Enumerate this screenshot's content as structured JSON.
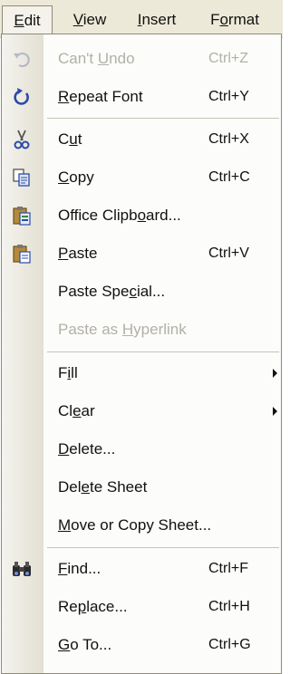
{
  "menubar": {
    "items": [
      {
        "label": "Edit",
        "mnemonic_index": 0,
        "active": true
      },
      {
        "label": "View",
        "mnemonic_index": 0
      },
      {
        "label": "Insert",
        "mnemonic_index": 0
      },
      {
        "label": "Format",
        "mnemonic_index": 1
      }
    ]
  },
  "menu": {
    "items": [
      {
        "label": "Can't Undo",
        "mnemonic_index": 6,
        "shortcut": "Ctrl+Z",
        "disabled": true,
        "icon": "undo-icon"
      },
      {
        "label": "Repeat Font",
        "mnemonic_index": 0,
        "shortcut": "Ctrl+Y",
        "icon": "repeat-icon"
      },
      {
        "label": "Cut",
        "mnemonic_index": 1,
        "shortcut": "Ctrl+X",
        "icon": "scissors-icon"
      },
      {
        "label": "Copy",
        "mnemonic_index": 0,
        "shortcut": "Ctrl+C",
        "icon": "copy-icon"
      },
      {
        "label": "Office Clipboard...",
        "mnemonic_index": 12,
        "icon": "clipboard-icon"
      },
      {
        "label": "Paste",
        "mnemonic_index": 0,
        "shortcut": "Ctrl+V",
        "icon": "paste-icon"
      },
      {
        "label": "Paste Special...",
        "mnemonic_index": 9
      },
      {
        "label": "Paste as Hyperlink",
        "mnemonic_index": 9,
        "disabled": true
      },
      {
        "label": "Fill",
        "mnemonic_index": 1,
        "submenu": true
      },
      {
        "label": "Clear",
        "mnemonic_index": 2,
        "submenu": true
      },
      {
        "label": "Delete...",
        "mnemonic_index": 0
      },
      {
        "label": "Delete Sheet",
        "mnemonic_index": 3
      },
      {
        "label": "Move or Copy Sheet...",
        "mnemonic_index": 0
      },
      {
        "label": "Find...",
        "mnemonic_index": 0,
        "shortcut": "Ctrl+F",
        "icon": "binoculars-icon"
      },
      {
        "label": "Replace...",
        "mnemonic_index": 2,
        "shortcut": "Ctrl+H"
      },
      {
        "label": "Go To...",
        "mnemonic_index": 0,
        "shortcut": "Ctrl+G"
      }
    ]
  },
  "colors": {
    "menubar_bg": "#ece9d8",
    "gutter": "#e3e0d2",
    "disabled_text": "#b2b0a6",
    "icon_blue": "#2b4aa8"
  }
}
